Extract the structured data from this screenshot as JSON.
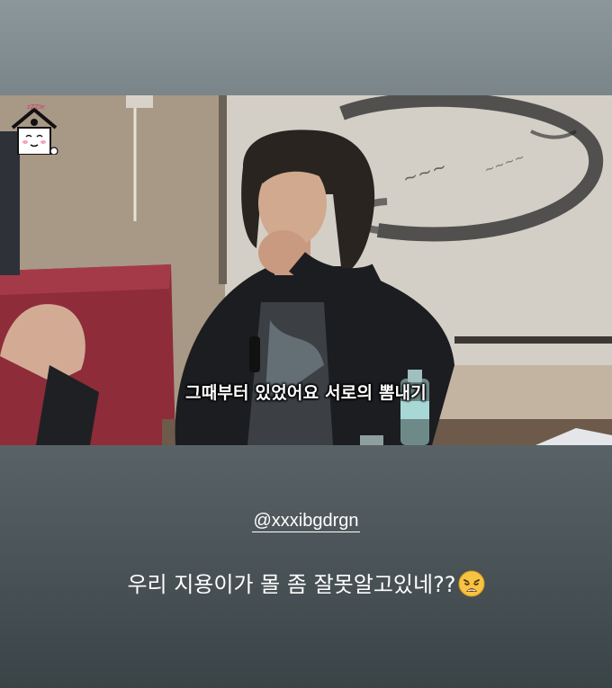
{
  "story": {
    "subtitle": "그때부터 있었어요 서로의 뽐내기",
    "mention": "@xxxibgdrgn",
    "caption": "우리 지용이가 몰 좀 잘못알고있네??",
    "caption_emoji": "weary-face-emoji",
    "logo_text": "zZZIe"
  },
  "colors": {
    "background_top": "#8c979b",
    "background_bottom": "#3a4346",
    "text": "#ffffff"
  }
}
